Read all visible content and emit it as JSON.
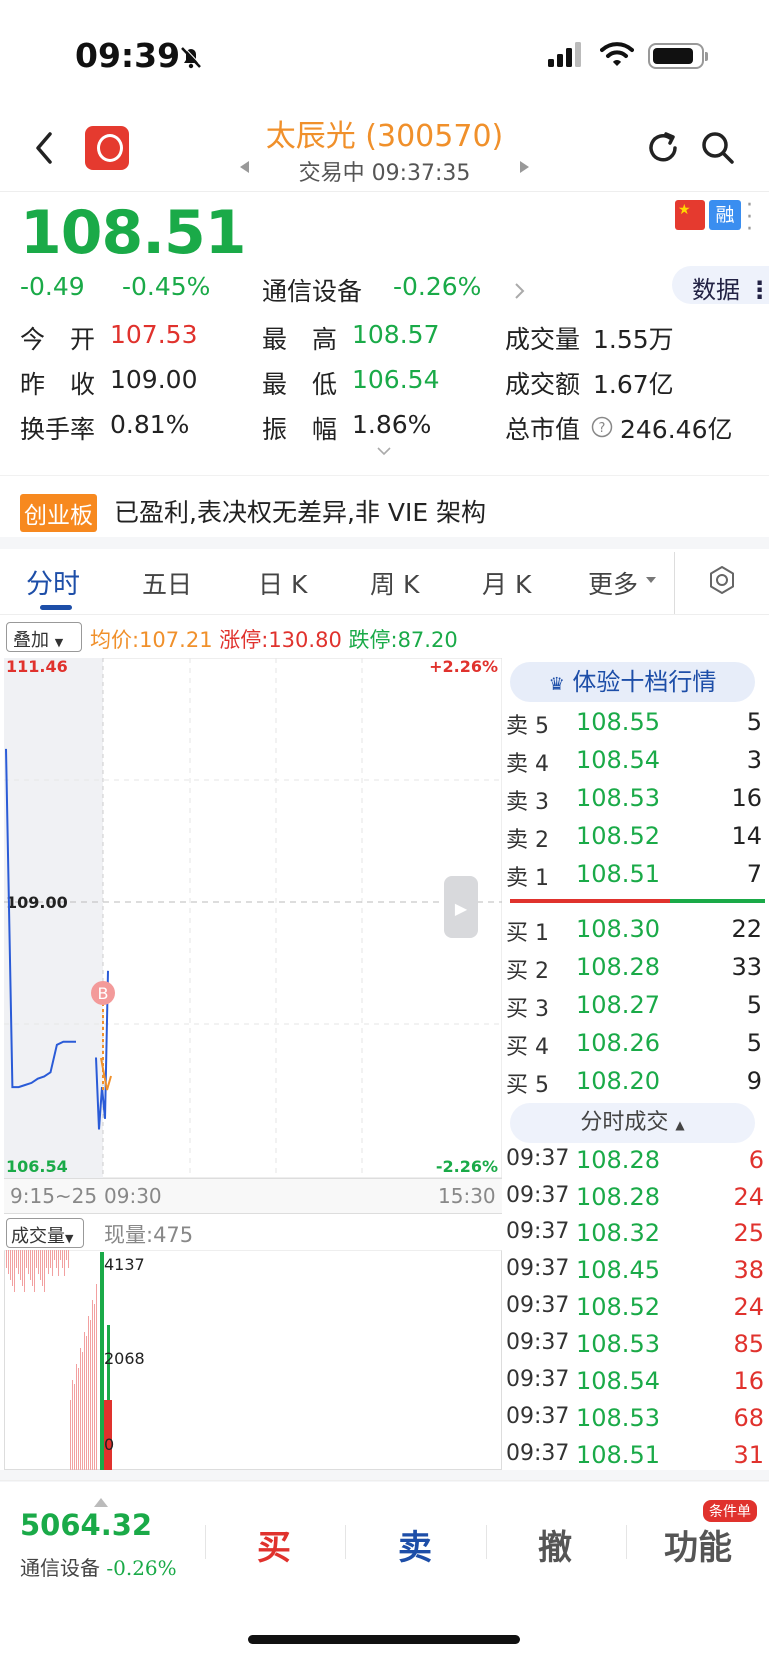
{
  "status_bar": {
    "time": "09:39"
  },
  "header": {
    "title": "太辰光 (300570)",
    "subtitle": "交易中 09:37:35"
  },
  "quote": {
    "price": "108.51",
    "change": "-0.49",
    "change_pct": "-0.45%",
    "sector": "通信设备",
    "sector_pct": "-0.26%",
    "data_button": "数据",
    "margin_badge": "融",
    "stats": [
      {
        "label": "今　开",
        "value": "107.53"
      },
      {
        "label": "最　高",
        "value": "108.57"
      },
      {
        "label": "成交量",
        "value": "1.55万"
      },
      {
        "label": "昨　收",
        "value": "109.00"
      },
      {
        "label": "最　低",
        "value": "106.54"
      },
      {
        "label": "成交额",
        "value": "1.67亿"
      },
      {
        "label": "换手率",
        "value": "0.81%"
      },
      {
        "label": "振　幅",
        "value": "1.86%"
      },
      {
        "label": "总市值",
        "value": "246.46亿"
      }
    ]
  },
  "board": {
    "tag": "创业板",
    "text": "已盈利,表决权无差异,非 VIE 架构"
  },
  "tabs": [
    "分时",
    "五日",
    "日 K",
    "周 K",
    "月 K",
    "更多"
  ],
  "chart_controls": {
    "overlay": "叠加",
    "avg_price": "均价:107.21",
    "limit_up": "涨停:130.80",
    "limit_down": "跌停:87.20",
    "volume_btn": "成交量",
    "current_volume": "现量:475"
  },
  "chart_data": {
    "type": "line",
    "price_max": "111.46",
    "price_ref": "109.00",
    "price_min": "106.54",
    "pct_max": "+2.26%",
    "pct_min": "-2.26%",
    "time_labels": [
      "9:15~25",
      "09:30",
      "15:30"
    ],
    "volume_ticks": [
      "4137",
      "2068",
      "0"
    ],
    "marker": "B",
    "ylim": [
      106.54,
      111.46
    ],
    "pre_market": [
      110.6,
      107.4,
      107.4,
      107.42,
      107.44,
      107.48,
      107.5,
      107.54,
      107.8,
      107.83,
      107.83,
      107.83
    ],
    "open_series": [
      107.68,
      107.0,
      107.4,
      107.1,
      108.5
    ]
  },
  "order_book": {
    "title": "体验十档行情",
    "asks": [
      {
        "label": "卖 5",
        "price": "108.55",
        "vol": "5"
      },
      {
        "label": "卖 4",
        "price": "108.54",
        "vol": "3"
      },
      {
        "label": "卖 3",
        "price": "108.53",
        "vol": "16"
      },
      {
        "label": "卖 2",
        "price": "108.52",
        "vol": "14"
      },
      {
        "label": "卖 1",
        "price": "108.51",
        "vol": "7"
      }
    ],
    "bids": [
      {
        "label": "买 1",
        "price": "108.30",
        "vol": "22"
      },
      {
        "label": "买 2",
        "price": "108.28",
        "vol": "33"
      },
      {
        "label": "买 3",
        "price": "108.27",
        "vol": "5"
      },
      {
        "label": "买 4",
        "price": "108.26",
        "vol": "5"
      },
      {
        "label": "买 5",
        "price": "108.20",
        "vol": "9"
      }
    ]
  },
  "trades": {
    "title": "分时成交",
    "rows": [
      {
        "time": "09:37",
        "price": "108.28",
        "vol": "6"
      },
      {
        "time": "09:37",
        "price": "108.28",
        "vol": "24"
      },
      {
        "time": "09:37",
        "price": "108.32",
        "vol": "25"
      },
      {
        "time": "09:37",
        "price": "108.45",
        "vol": "38"
      },
      {
        "time": "09:37",
        "price": "108.52",
        "vol": "24"
      },
      {
        "time": "09:37",
        "price": "108.53",
        "vol": "85"
      },
      {
        "time": "09:37",
        "price": "108.54",
        "vol": "16"
      },
      {
        "time": "09:37",
        "price": "108.53",
        "vol": "68"
      },
      {
        "time": "09:37",
        "price": "108.51",
        "vol": "31"
      }
    ]
  },
  "bottom_bar": {
    "index_value": "5064.32",
    "index_name": "通信设备",
    "index_pct": "-0.26%",
    "buy": "买",
    "sell": "卖",
    "cancel": "撤",
    "func": "功能",
    "func_badge": "条件单"
  },
  "colors": {
    "up": "#e0322d",
    "down": "#1aaa48",
    "accent": "#1d4ea8",
    "title": "#f0902b",
    "line": "#2a5bd7"
  }
}
